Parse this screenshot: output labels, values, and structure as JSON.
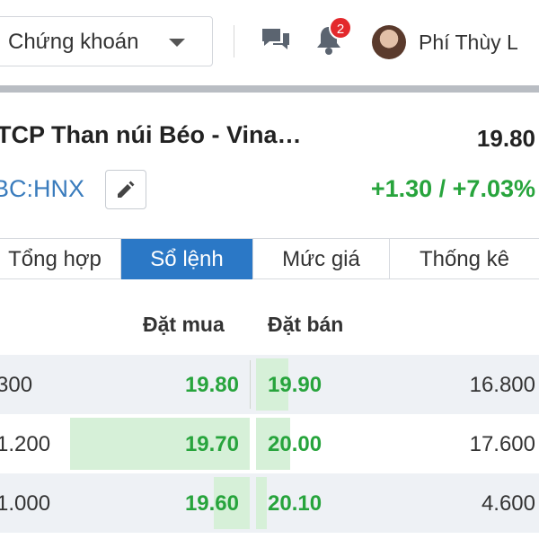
{
  "header": {
    "market_select": "Chứng khoán",
    "notification_count": "2",
    "user_name": "Phí Thùy L"
  },
  "stock": {
    "name": "TCP Than núi Béo - Vina…",
    "price": "19.80",
    "code": "BC:HNX",
    "change": "+1.30 / +7.03%"
  },
  "tabs": [
    {
      "label": "Tổng hợp",
      "active": false
    },
    {
      "label": "Sổ lệnh",
      "active": true
    },
    {
      "label": "Mức giá",
      "active": false
    },
    {
      "label": "Thống kê",
      "active": false
    }
  ],
  "order_book": {
    "buy_header": "Đặt mua",
    "sell_header": "Đặt bán",
    "rows": [
      {
        "buy_volume": "300",
        "buy_price": "19.80",
        "sell_price": "19.90",
        "sell_volume": "16.800"
      },
      {
        "buy_volume": "1.200",
        "buy_price": "19.70",
        "sell_price": "20.00",
        "sell_volume": "17.600"
      },
      {
        "buy_volume": "1.000",
        "buy_price": "19.60",
        "sell_price": "20.10",
        "sell_volume": "4.600"
      }
    ]
  },
  "colors": {
    "accent": "#2b78c6",
    "up": "#27a43c",
    "badge": "#e3282c"
  }
}
